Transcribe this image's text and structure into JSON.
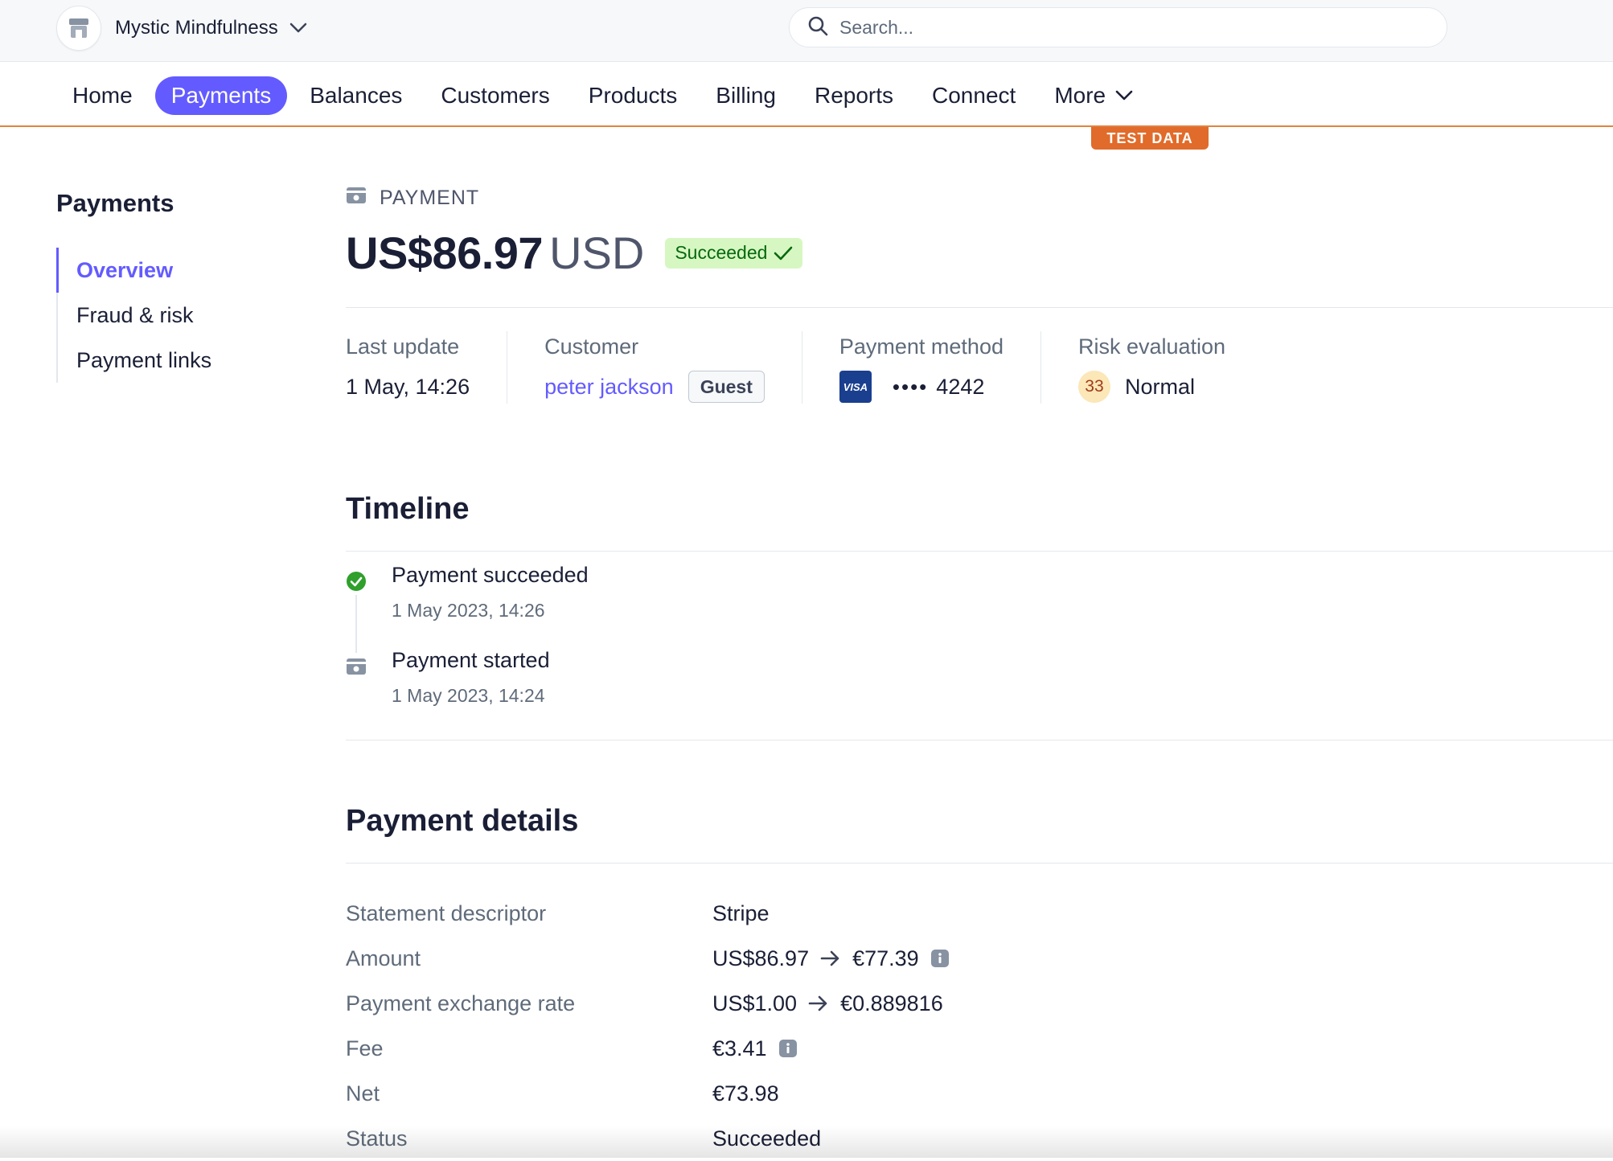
{
  "topbar": {
    "account_name": "Mystic Mindfulness",
    "search_placeholder": "Search..."
  },
  "nav": {
    "items": [
      {
        "label": "Home"
      },
      {
        "label": "Payments"
      },
      {
        "label": "Balances"
      },
      {
        "label": "Customers"
      },
      {
        "label": "Products"
      },
      {
        "label": "Billing"
      },
      {
        "label": "Reports"
      },
      {
        "label": "Connect"
      },
      {
        "label": "More"
      }
    ],
    "active": "Payments",
    "test_badge": "TEST DATA"
  },
  "sidebar": {
    "title": "Payments",
    "items": [
      {
        "label": "Overview"
      },
      {
        "label": "Fraud & risk"
      },
      {
        "label": "Payment links"
      }
    ],
    "active": "Overview"
  },
  "payment": {
    "kind_label": "PAYMENT",
    "amount": "US$86.97",
    "currency": "USD",
    "status": "Succeeded",
    "summary": {
      "last_update_label": "Last update",
      "last_update_value": "1 May, 14:26",
      "customer_label": "Customer",
      "customer_name": "peter jackson",
      "customer_badge": "Guest",
      "method_label": "Payment method",
      "card_brand": "VISA",
      "card_dots": "••••",
      "card_last4": "4242",
      "risk_label": "Risk evaluation",
      "risk_score": "33",
      "risk_level": "Normal"
    }
  },
  "timeline": {
    "title": "Timeline",
    "events": [
      {
        "title": "Payment succeeded",
        "date": "1 May 2023, 14:26",
        "icon": "check-circle-icon"
      },
      {
        "title": "Payment started",
        "date": "1 May 2023, 14:24",
        "icon": "payment-icon"
      }
    ]
  },
  "details": {
    "title": "Payment details",
    "rows": [
      {
        "label": "Statement descriptor",
        "value": "Stripe"
      },
      {
        "label": "Amount",
        "from": "US$86.97",
        "to": "€77.39"
      },
      {
        "label": "Payment exchange rate",
        "from": "US$1.00",
        "to": "€0.889816"
      },
      {
        "label": "Fee",
        "value": "€3.41"
      },
      {
        "label": "Net",
        "value": "€73.98"
      },
      {
        "label": "Status",
        "value": "Succeeded"
      }
    ]
  },
  "colors": {
    "accent": "#635bff",
    "test_badge": "#e16b2a",
    "success_bg": "#d7f7c2",
    "success_fg": "#05690d"
  }
}
